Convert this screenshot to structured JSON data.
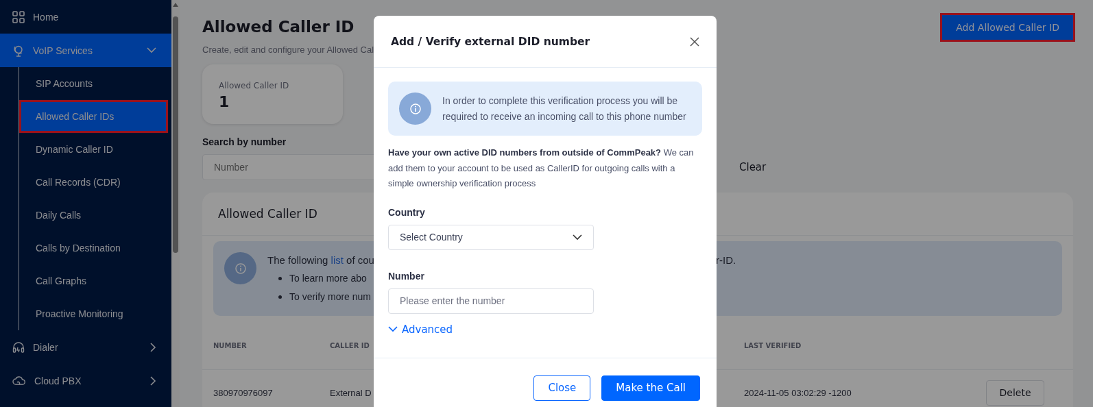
{
  "sidebar": {
    "items": [
      {
        "label": "Home",
        "kind": "link",
        "selected": false,
        "highlighted": false
      },
      {
        "label": "VoIP Services",
        "kind": "group",
        "selected": true,
        "highlighted": false,
        "expanded": true,
        "children": [
          {
            "label": "SIP Accounts",
            "selected": false,
            "highlighted": false
          },
          {
            "label": "Allowed Caller IDs",
            "selected": true,
            "highlighted": true
          },
          {
            "label": "Dynamic Caller ID",
            "selected": false,
            "highlighted": false
          },
          {
            "label": "Call Records (CDR)",
            "selected": false,
            "highlighted": false
          },
          {
            "label": "Daily Calls",
            "selected": false,
            "highlighted": false
          },
          {
            "label": "Calls by Destination",
            "selected": false,
            "highlighted": false
          },
          {
            "label": "Call Graphs",
            "selected": false,
            "highlighted": false
          },
          {
            "label": "Proactive Monitoring",
            "selected": false,
            "highlighted": false
          }
        ]
      },
      {
        "label": "Dialer",
        "kind": "group",
        "selected": false,
        "highlighted": false,
        "expanded": false
      },
      {
        "label": "Cloud PBX",
        "kind": "group",
        "selected": false,
        "highlighted": false,
        "expanded": false
      }
    ]
  },
  "page": {
    "title": "Allowed Caller ID",
    "subtitle": "Create, edit and configure your Allowed Cal",
    "add_button": {
      "label": "Add Allowed Caller ID",
      "highlighted": true
    },
    "stat": {
      "label": "Allowed Caller ID",
      "value": "1"
    },
    "search": {
      "label": "Search by number",
      "placeholder": "Number",
      "clear": "Clear"
    },
    "table_card": {
      "title": "Allowed Caller ID",
      "notice": {
        "text_before": "The following ",
        "link": "list",
        "text_after": " of cou",
        "text_right": "r-ID.",
        "bullets": [
          "To learn more abo",
          "To verify more num"
        ]
      },
      "columns": [
        "NUMBER",
        "CALLER ID",
        "LAST VERIFIED"
      ],
      "rows": [
        {
          "cells": [
            "380970976097",
            "External D",
            "2024-11-05 03:02:29 -1200"
          ],
          "action": "Delete"
        }
      ]
    }
  },
  "modal": {
    "title": "Add / Verify external DID number",
    "notice": "In order to complete this verification process you will be required to receive an incoming call to this phone number",
    "intro": "**Have your own active DID numbers from outside of CommPeak?** We can add them to your account to be used as CallerID for outgoing calls with a simple ownership verification process",
    "fields": [
      {
        "kind": "select",
        "label": "Country",
        "placeholder": "Select Country"
      },
      {
        "kind": "input",
        "label": "Number",
        "placeholder": "Please enter the number"
      }
    ],
    "advanced": {
      "label": "Advanced",
      "expanded": false
    },
    "buttons": [
      {
        "label": "Close",
        "kind": "secondary"
      },
      {
        "label": "Make the Call",
        "kind": "primary"
      }
    ]
  }
}
